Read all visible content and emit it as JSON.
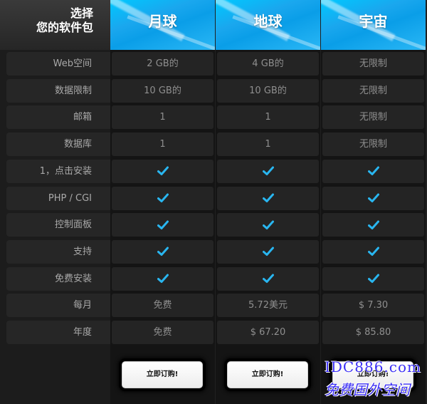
{
  "corner": {
    "line1": "选择",
    "line2": "您的软件包"
  },
  "rows": [
    {
      "label": "Web空间"
    },
    {
      "label": "数据限制"
    },
    {
      "label": "邮箱"
    },
    {
      "label": "数据库"
    },
    {
      "label": "1，点击安装"
    },
    {
      "label": "PHP / CGI"
    },
    {
      "label": "控制面板"
    },
    {
      "label": "支持"
    },
    {
      "label": "免费安装"
    },
    {
      "label": "每月"
    },
    {
      "label": "年度"
    }
  ],
  "plans": [
    {
      "name": "月球",
      "values": [
        "2 GB的",
        "10 GB的",
        "1",
        "1",
        "check",
        "check",
        "check",
        "check",
        "check",
        "免费",
        "免费"
      ],
      "button": "立即订购!"
    },
    {
      "name": "地球",
      "values": [
        "4 GB的",
        "10 GB的",
        "1",
        "1",
        "check",
        "check",
        "check",
        "check",
        "check",
        "5.72美元",
        "$ 67.20"
      ],
      "button": "立即订购!"
    },
    {
      "name": "宇宙",
      "values": [
        "无限制",
        "无限制",
        "无限制",
        "无限制",
        "check",
        "check",
        "check",
        "check",
        "check",
        "$ 7.30",
        "$ 85.80"
      ],
      "button": "立即订购!"
    }
  ],
  "watermark": {
    "line1": "IDC886.com",
    "line2": "免费国外空间"
  },
  "colors": {
    "header_blue": "#0aa6ee",
    "check": "#29b6f0",
    "cell_text": "#8f8f8f",
    "label_text": "#a9a9a9"
  },
  "icons": {
    "check": "check-icon"
  }
}
